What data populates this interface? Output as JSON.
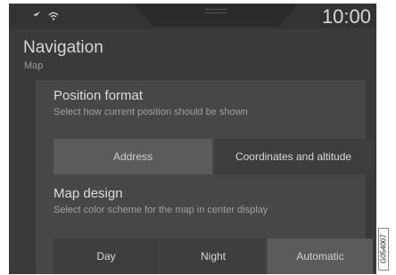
{
  "status": {
    "time": "10:00",
    "icons": [
      "navigation-arrow-icon",
      "wifi-icon"
    ]
  },
  "header": {
    "title": "Navigation",
    "subtitle": "Map"
  },
  "position_format": {
    "title": "Position format",
    "description": "Select how current position should be shown",
    "options": [
      "Address",
      "Coordinates and altitude"
    ],
    "selected": "Address"
  },
  "map_design": {
    "title": "Map design",
    "description": "Select color scheme for the map in center display",
    "options": [
      "Day",
      "Night",
      "Automatic"
    ],
    "selected": "Automatic"
  },
  "reference_code": "G054007",
  "colors": {
    "background": "#3a3a3a",
    "panel": "#474747",
    "selected": "#5b5b5b"
  }
}
